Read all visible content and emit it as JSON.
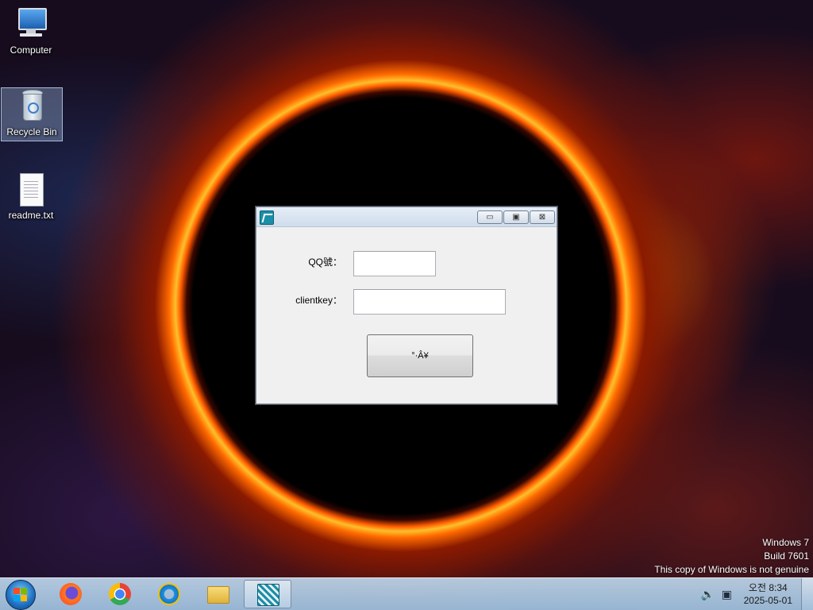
{
  "desktop": {
    "icons": [
      {
        "label": "Computer",
        "icon": "computer-icon"
      },
      {
        "label": "Recycle Bin",
        "icon": "recycle-bin-icon"
      },
      {
        "label": "readme.txt",
        "icon": "text-file-icon"
      }
    ]
  },
  "dialog": {
    "title": "",
    "qq_label": "QQ號：",
    "qq_value": "",
    "clientkey_label": "clientkey：",
    "clientkey_value": "",
    "button_label": "°·Â¥",
    "minimize_glyph": "▭",
    "maximize_glyph": "▣",
    "close_glyph": "⊠"
  },
  "watermark": {
    "line1": "Windows 7",
    "line2": "Build 7601",
    "line3": "This copy of Windows is not genuine"
  },
  "taskbar": {
    "items": [
      "firefox-icon",
      "chrome-icon",
      "internet-explorer-icon",
      "file-explorer-icon",
      "app-window-icon"
    ],
    "clock_time": "오전 8:34",
    "clock_date": "2025-05-01"
  }
}
